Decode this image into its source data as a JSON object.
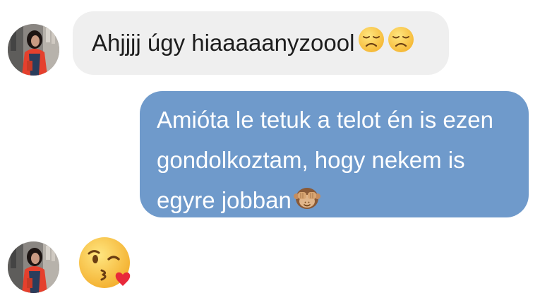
{
  "conversation": {
    "messages": [
      {
        "direction": "incoming",
        "text": "Ahjjjj úgy hiaaaaanyzoool",
        "emoji": [
          "disappointed-face-icon",
          "disappointed-face-icon"
        ]
      },
      {
        "direction": "outgoing",
        "text": "Amióta le tetuk a telot én is ezen gondolkoztam, hogy nekem is egyre jobban",
        "emoji": [
          "see-no-evil-monkey-icon"
        ]
      },
      {
        "direction": "incoming",
        "text": "",
        "emoji": [
          "face-blowing-kiss-icon"
        ]
      }
    ]
  },
  "colors": {
    "incoming_bubble": "#efefef",
    "outgoing_bubble": "#6f9acb",
    "incoming_text": "#1d1d1d",
    "outgoing_text": "#ffffff",
    "background": "#ffffff"
  }
}
